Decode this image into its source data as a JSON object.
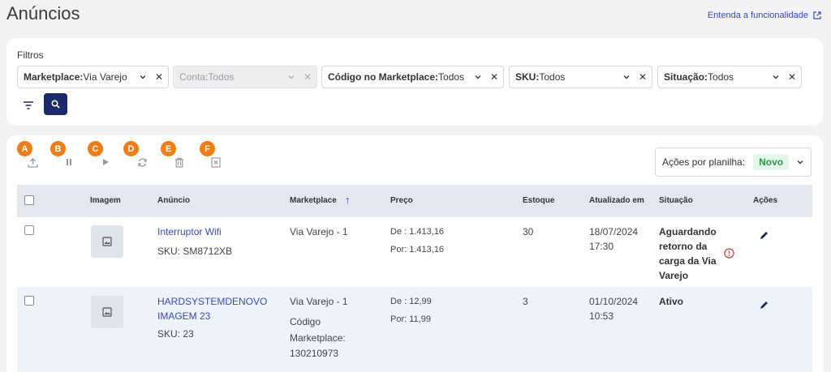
{
  "header": {
    "title": "Anúncios",
    "help_link": "Entenda a funcionalidade"
  },
  "filters": {
    "label": "Filtros",
    "items": [
      {
        "name": "Marketplace:",
        "value": " Via Varejo"
      },
      {
        "name": "Conta:",
        "value": " Todos"
      },
      {
        "name": "Código no Marketplace:",
        "value": "Todos"
      },
      {
        "name": "SKU:",
        "value": "Todos"
      },
      {
        "name": "Situação:",
        "value": "Todos"
      }
    ]
  },
  "toolbar": {
    "badges": [
      "A",
      "B",
      "C",
      "D",
      "E",
      "F"
    ],
    "icons": [
      "upload-icon",
      "pause-icon",
      "play-icon",
      "sync-icon",
      "trash-icon",
      "close-box-icon"
    ],
    "actions_label": "Ações por planilha:",
    "actions_tag": "Novo"
  },
  "table": {
    "columns": [
      "Imagem",
      "Anúncio",
      "Marketplace",
      "Preço",
      "Estoque",
      "Atualizado em",
      "Situação",
      "Ações"
    ],
    "sort_indicator": "↑",
    "rows": [
      {
        "title": "Interruptor Wifi",
        "sku": "SKU: SM8712XB",
        "marketplace": "Via Varejo - 1",
        "marketplace_code_label": "",
        "marketplace_code": "",
        "price_de": "De : 1.413,16",
        "price_por": "Por: 1.413,16",
        "stock": "30",
        "updated_date": "18/07/2024",
        "updated_time": "17:30",
        "status": "Aguardando retorno da carga da Via Varejo"
      },
      {
        "title": "HARDSYSTEMDENOVO IMAGEM 23",
        "sku": "SKU: 23",
        "marketplace": "Via Varejo - 1",
        "marketplace_code_label": "Código Marketplace:",
        "marketplace_code": "130210973",
        "price_de": "De : 12,99",
        "price_por": "Por: 11,99",
        "stock": "3",
        "updated_date": "01/10/2024",
        "updated_time": "10:53",
        "status": "Ativo"
      }
    ]
  },
  "colors": {
    "accent": "#3848c8",
    "primary_button": "#1b2a6b",
    "badge": "#f07c12",
    "new_tag": "#2a9a4e",
    "warning": "#d9342b"
  }
}
